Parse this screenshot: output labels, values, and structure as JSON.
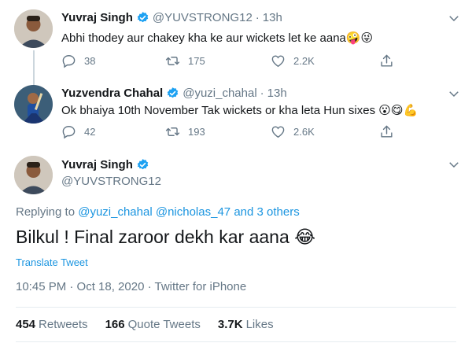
{
  "tweets": [
    {
      "name": "Yuvraj Singh",
      "handle": "@YUVSTRONG12",
      "separator": "·",
      "time": "13h",
      "text": "Abhi thodey aur chakey kha ke aur wickets let ke aana",
      "emojis": "🤪😜",
      "replies": "38",
      "retweets": "175",
      "likes": "2.2K"
    },
    {
      "name": "Yuzvendra Chahal",
      "handle": "@yuzi_chahal",
      "separator": "·",
      "time": "13h",
      "text": "Ok bhaiya 10th November Tak wickets or kha leta Hun sixes",
      "emojis": "😮😋💪",
      "replies": "42",
      "retweets": "193",
      "likes": "2.6K"
    }
  ],
  "main_tweet": {
    "name": "Yuvraj Singh",
    "handle": "@YUVSTRONG12",
    "replying_prefix": "Replying to",
    "mention_1": "@yuzi_chahal",
    "mention_2": "@nicholas_47",
    "others": "and 3 others",
    "text": "Bilkul  ! Final zaroor dekh kar aana",
    "emoji": "😂",
    "translate": "Translate Tweet",
    "meta": "10:45 PM · Oct 18, 2020 · Twitter for iPhone",
    "stats": {
      "retweets_count": "454",
      "retweets_label": "Retweets",
      "quotes_count": "166",
      "quotes_label": "Quote Tweets",
      "likes_count": "3.7K",
      "likes_label": "Likes"
    }
  },
  "colors": {
    "link": "#1b95e0",
    "secondary": "#657786",
    "verified": "#1da1f2"
  },
  "icons": {
    "verified": "verified-badge-icon",
    "caret": "chevron-down-icon",
    "reply": "reply-icon",
    "retweet": "retweet-icon",
    "like": "heart-icon",
    "share": "share-icon"
  }
}
